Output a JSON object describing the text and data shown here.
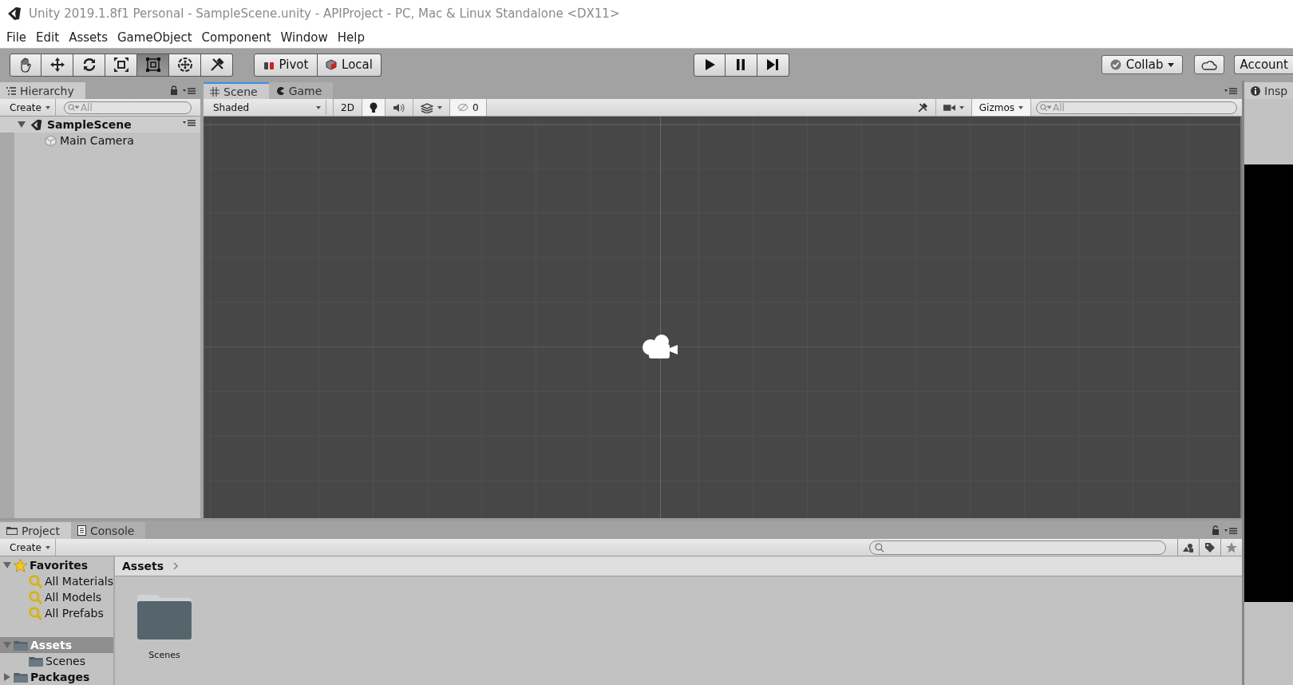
{
  "window": {
    "title": "Unity 2019.1.8f1 Personal - SampleScene.unity - APIProject - PC, Mac & Linux Standalone <DX11>"
  },
  "menu": [
    "File",
    "Edit",
    "Assets",
    "GameObject",
    "Component",
    "Window",
    "Help"
  ],
  "toolbar": {
    "tools": [
      {
        "kind": "hand",
        "selected": false
      },
      {
        "kind": "move",
        "selected": false
      },
      {
        "kind": "rotate",
        "selected": false
      },
      {
        "kind": "scale",
        "selected": false
      },
      {
        "kind": "rect",
        "selected": true
      },
      {
        "kind": "transform",
        "selected": false
      },
      {
        "kind": "custom",
        "selected": false
      }
    ],
    "pivot": "Pivot",
    "local": "Local",
    "collab": "Collab",
    "account": "Account"
  },
  "hierarchy": {
    "tab": "Hierarchy",
    "create": "Create",
    "search_placeholder": "All",
    "scene": {
      "name": "SampleScene",
      "expanded": true,
      "children": [
        {
          "name": "Main Camera"
        }
      ]
    }
  },
  "scene_view": {
    "tabs": [
      {
        "label": "Scene",
        "kind": "scene",
        "selected": true
      },
      {
        "label": "Game",
        "kind": "game",
        "selected": false
      }
    ],
    "shading": "Shaded",
    "mode_2d": "2D",
    "mode_2d_on": false,
    "lighting_on": true,
    "audio_on": false,
    "effects_on": false,
    "hidden_on": true,
    "tools_on": false,
    "gizmos_on": true,
    "hidden_count": "0",
    "gizmos": "Gizmos",
    "search_placeholder": "All"
  },
  "inspector": {
    "tab": "Insp"
  },
  "project": {
    "tabs": [
      {
        "label": "Project",
        "kind": "project",
        "selected": true
      },
      {
        "label": "Console",
        "kind": "console",
        "selected": false
      }
    ],
    "create": "Create",
    "tree": [
      {
        "label": "Favorites",
        "kind": "favorites",
        "expanded": true,
        "selected": false,
        "children": [
          {
            "label": "All Materials",
            "kind": "search",
            "selected": false
          },
          {
            "label": "All Models",
            "kind": "search",
            "selected": false
          },
          {
            "label": "All Prefabs",
            "kind": "search",
            "selected": false
          }
        ]
      },
      {
        "label": "Assets",
        "kind": "folder",
        "expanded": true,
        "selected": true,
        "children": [
          {
            "label": "Scenes",
            "kind": "folder",
            "selected": false
          }
        ]
      },
      {
        "label": "Packages",
        "kind": "folder",
        "expanded": false,
        "selected": false
      }
    ],
    "breadcrumb": "Assets",
    "items": [
      {
        "name": "Scenes"
      }
    ]
  }
}
